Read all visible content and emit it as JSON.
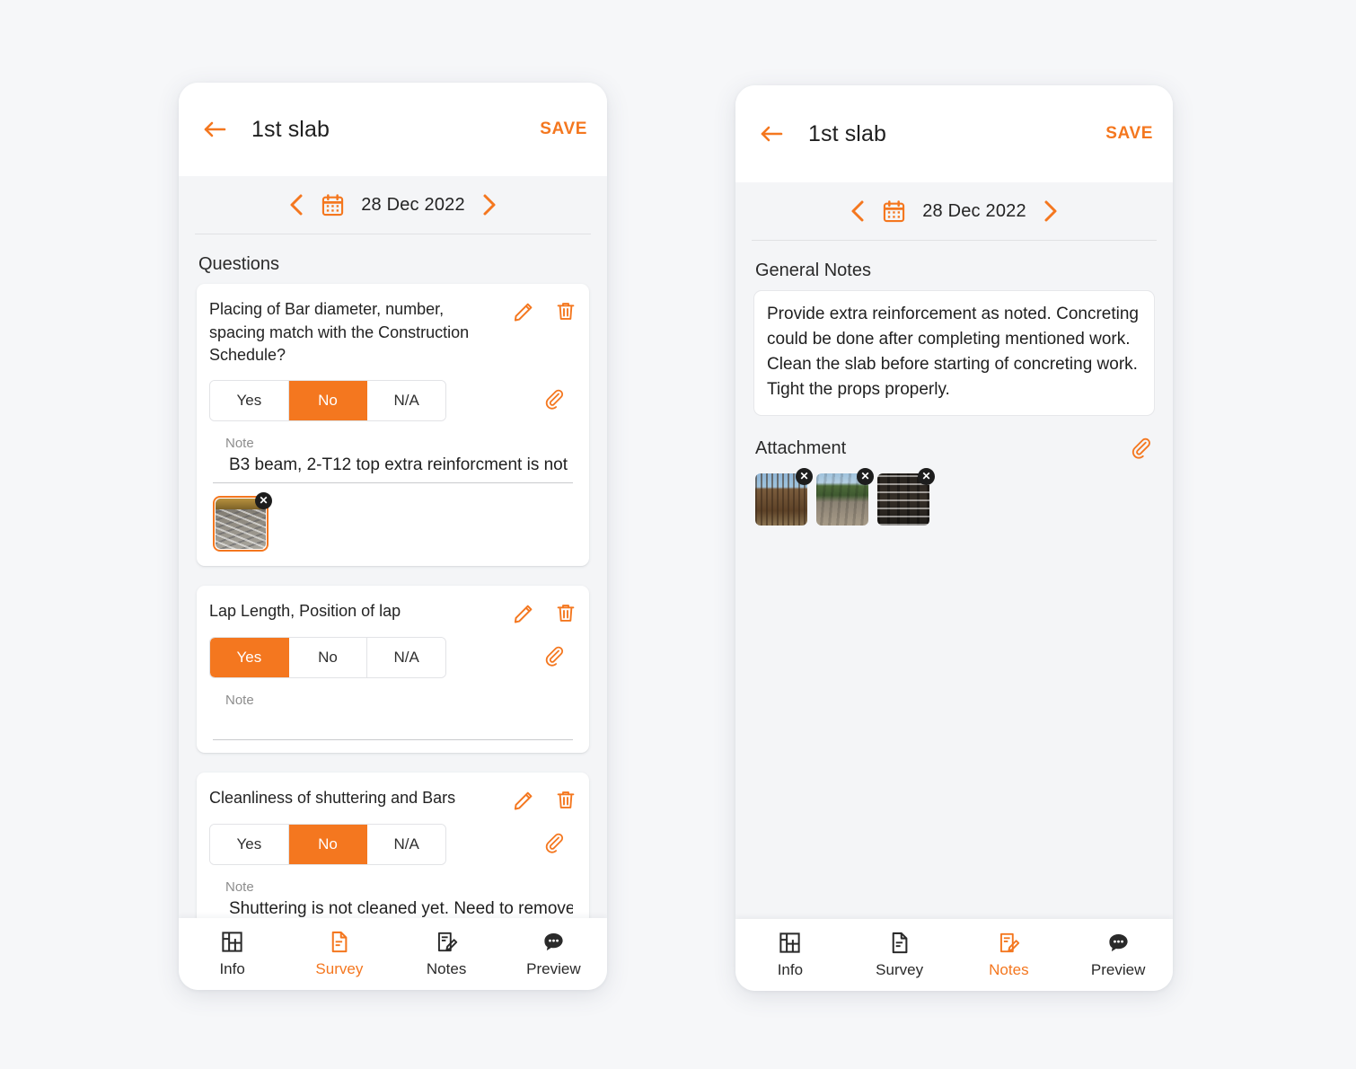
{
  "theme": {
    "accent": "#f4771f",
    "page_bg": "#f6f7f9",
    "screen_bg": "#f4f5f7",
    "card_bg": "#ffffff",
    "text": "#232323",
    "muted": "#8d8d8d"
  },
  "survey_screen": {
    "appbar": {
      "back_icon": "arrow-left-icon",
      "title": "1st slab",
      "save_label": "SAVE"
    },
    "datebar": {
      "prev_icon": "chevron-left-icon",
      "calendar_icon": "calendar-icon",
      "date": "28 Dec 2022",
      "next_icon": "chevron-right-icon"
    },
    "section_title": "Questions",
    "questions": [
      {
        "text": "Placing of Bar diameter, number, spacing match with the Construction Schedule?",
        "edit_icon": "pencil-icon",
        "delete_icon": "trash-icon",
        "attach_icon": "paperclip-icon",
        "options": [
          "Yes",
          "No",
          "N/A"
        ],
        "selected": "No",
        "note_label": "Note",
        "note_value": "B3 beam, 2-T12 top extra reinforcment is not",
        "attachments": [
          {
            "alt": "rebar-photo",
            "texture": "ph-rebar",
            "selected": true,
            "remove_icon": "close-icon"
          }
        ]
      },
      {
        "text": "Lap Length, Position of lap",
        "edit_icon": "pencil-icon",
        "delete_icon": "trash-icon",
        "attach_icon": "paperclip-icon",
        "options": [
          "Yes",
          "No",
          "N/A"
        ],
        "selected": "Yes",
        "note_label": "Note",
        "note_value": "",
        "attachments": []
      },
      {
        "text": "Cleanliness of shuttering and Bars",
        "edit_icon": "pencil-icon",
        "delete_icon": "trash-icon",
        "attach_icon": "paperclip-icon",
        "options": [
          "Yes",
          "No",
          "N/A"
        ],
        "selected": "No",
        "note_label": "Note",
        "note_value": "Shuttering is not cleaned yet. Need to remove",
        "attachments": []
      }
    ],
    "bottom_nav": {
      "items": [
        {
          "label": "Info",
          "icon": "floorplan-icon",
          "active": false
        },
        {
          "label": "Survey",
          "icon": "document-icon",
          "active": true
        },
        {
          "label": "Notes",
          "icon": "note-pencil-icon",
          "active": false
        },
        {
          "label": "Preview",
          "icon": "comment-icon",
          "active": false
        }
      ]
    }
  },
  "notes_screen": {
    "appbar": {
      "back_icon": "arrow-left-icon",
      "title": "1st slab",
      "save_label": "SAVE"
    },
    "datebar": {
      "prev_icon": "chevron-left-icon",
      "calendar_icon": "calendar-icon",
      "date": "28 Dec 2022",
      "next_icon": "chevron-right-icon"
    },
    "section_title": "General Notes",
    "general_notes": "Provide extra reinforcement as noted. Concreting could be done after completing mentioned work. Clean the slab before starting of concreting work. Tight the props properly.",
    "attachment": {
      "title": "Attachment",
      "attach_icon": "paperclip-icon",
      "items": [
        {
          "alt": "timber-formwork-photo",
          "texture": "ph-timber",
          "remove_icon": "close-icon"
        },
        {
          "alt": "site-ground-photo",
          "texture": "ph-site",
          "remove_icon": "close-icon"
        },
        {
          "alt": "stacked-formwork-photo",
          "texture": "ph-stack",
          "remove_icon": "close-icon"
        }
      ]
    },
    "bottom_nav": {
      "items": [
        {
          "label": "Info",
          "icon": "floorplan-icon",
          "active": false
        },
        {
          "label": "Survey",
          "icon": "document-icon",
          "active": false
        },
        {
          "label": "Notes",
          "icon": "note-pencil-icon",
          "active": true
        },
        {
          "label": "Preview",
          "icon": "comment-icon",
          "active": false
        }
      ]
    }
  }
}
